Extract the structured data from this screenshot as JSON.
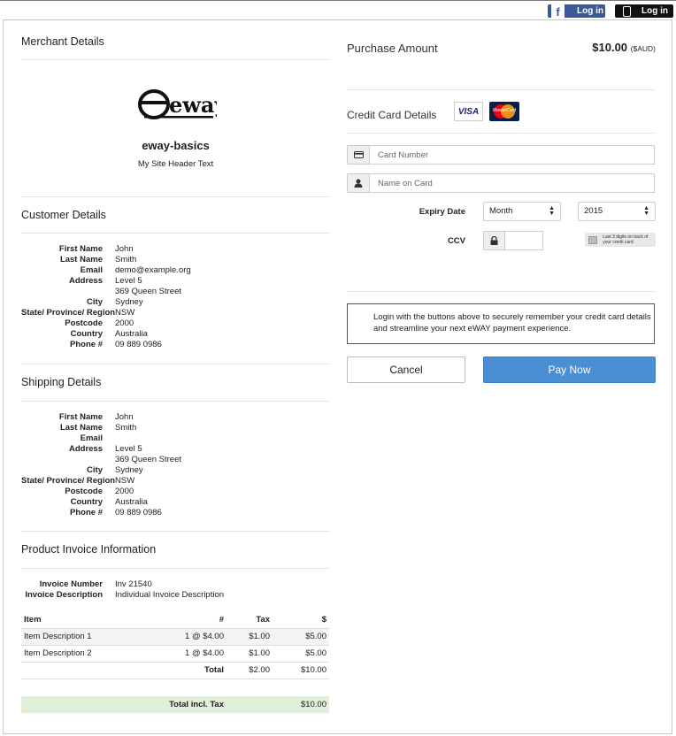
{
  "top_bar": {
    "facebook_login": {
      "icon": "facebook-icon",
      "label": "Log in",
      "color": "#3b5998"
    },
    "mobile_login": {
      "icon": "phone-icon",
      "label": "Log in",
      "color": "#111111"
    }
  },
  "merchant": {
    "section_title": "Merchant Details",
    "logo_text": "eway",
    "name": "eway-basics",
    "header_text": "My Site Header Text"
  },
  "customer": {
    "section_title": "Customer Details",
    "fields": [
      {
        "label": "First Name",
        "value": "John"
      },
      {
        "label": "Last Name",
        "value": "Smith"
      },
      {
        "label": "Email",
        "value": "demo@example.org"
      },
      {
        "label": "Address",
        "value": "Level 5"
      },
      {
        "label": "",
        "value": "369 Queen Street"
      },
      {
        "label": "City",
        "value": "Sydney"
      },
      {
        "label": "State/ Province/ Region",
        "value": "NSW"
      },
      {
        "label": "Postcode",
        "value": "2000"
      },
      {
        "label": "Country",
        "value": "Australia"
      },
      {
        "label": "Phone #",
        "value": "09 889 0986"
      }
    ]
  },
  "shipping": {
    "section_title": "Shipping Details",
    "fields": [
      {
        "label": "First Name",
        "value": "John"
      },
      {
        "label": "Last Name",
        "value": "Smith"
      },
      {
        "label": "Email",
        "value": ""
      },
      {
        "label": "Address",
        "value": "Level 5"
      },
      {
        "label": "",
        "value": "369 Queen Street"
      },
      {
        "label": "City",
        "value": "Sydney"
      },
      {
        "label": "State/ Province/ Region",
        "value": "NSW"
      },
      {
        "label": "Postcode",
        "value": "2000"
      },
      {
        "label": "Country",
        "value": "Australia"
      },
      {
        "label": "Phone #",
        "value": "09 889 0986"
      }
    ]
  },
  "invoice": {
    "section_title": "Product Invoice Information",
    "fields": [
      {
        "label": "Invoice Number",
        "value": "Inv 21540"
      },
      {
        "label": "Invoice Description",
        "value": "Individual Invoice Description"
      }
    ],
    "table": {
      "headers": [
        "Item",
        "#",
        "Tax",
        "$"
      ],
      "rows": [
        [
          "Item Description 1",
          "1 @ $4.00",
          "$1.00",
          "$5.00"
        ],
        [
          "Item Description 2",
          "1 @ $4.00",
          "$1.00",
          "$5.00"
        ]
      ],
      "total_row": {
        "label": "Total",
        "tax": "$2.00",
        "amount": "$10.00"
      },
      "grand_total": {
        "label": "Total incl. Tax",
        "amount": "$10.00",
        "color": "#dfefd8"
      }
    }
  },
  "purchase": {
    "title": "Purchase Amount",
    "amount": "$10.00",
    "currency": "($AUD)"
  },
  "credit_card": {
    "title": "Credit Card Details",
    "brands": {
      "visa": "VISA",
      "mastercard": "MasterCard"
    },
    "card_number_placeholder": "Card Number",
    "name_placeholder": "Name on Card",
    "expiry_label": "Expiry Date",
    "month_value": "Month",
    "year_value": "2015",
    "ccv_label": "CCV",
    "ccv_hint": "Last 3 digits on back of your credit card"
  },
  "info_message": "Login with the buttons above to securely remember your credit card details and streamline your next eWAY payment experience.",
  "actions": {
    "cancel": "Cancel",
    "pay": "Pay Now",
    "pay_color": "#4a8fd4"
  }
}
